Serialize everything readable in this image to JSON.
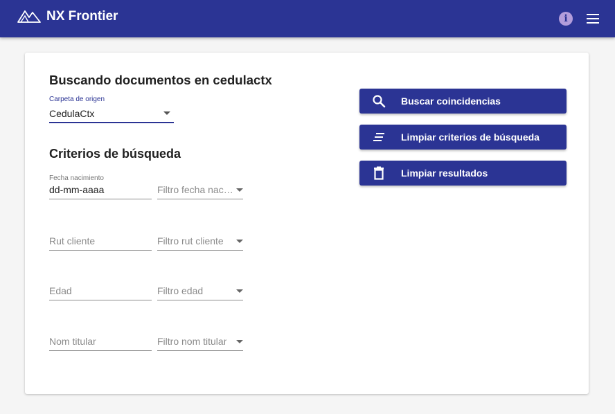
{
  "app": {
    "title": "NX Frontier"
  },
  "icons": {
    "logo": "mountains-logo-icon",
    "info": "info-icon",
    "menu": "menu-icon",
    "search": "search-icon",
    "clear": "clear-lines-icon",
    "delete": "trash-icon"
  },
  "colors": {
    "primary": "#2b3494",
    "info_badge": "#b39ddb",
    "background": "#f5f5f5"
  },
  "header": {
    "info_glyph": "i"
  },
  "main": {
    "title": "Buscando documentos en cedulactx",
    "source_folder": {
      "label": "Carpeta de origen",
      "value": "CedulaCtx"
    },
    "criteria_title": "Criterios de búsqueda",
    "criteria": [
      {
        "label": "Fecha nacimiento",
        "value": "dd-mm-aaaa",
        "filter_placeholder": "Filtro fecha nacimiento"
      },
      {
        "placeholder": "Rut cliente",
        "filter_placeholder": "Filtro rut cliente"
      },
      {
        "placeholder": "Edad",
        "filter_placeholder": "Filtro edad"
      },
      {
        "placeholder": "Nom titular",
        "filter_placeholder": "Filtro nom titular"
      }
    ]
  },
  "actions": {
    "search_label": "Buscar coincidencias",
    "clear_criteria_label": "Limpiar criterios de búsqueda",
    "clear_results_label": "Limpiar resultados"
  }
}
